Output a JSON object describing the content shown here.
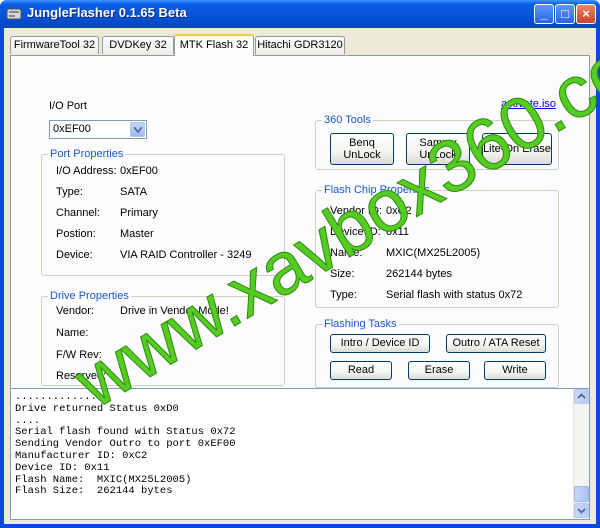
{
  "window": {
    "title": "JungleFlasher 0.1.65 Beta",
    "minimize": "_",
    "maximize": "□",
    "close": "×"
  },
  "tabs": [
    {
      "label": "FirmwareTool 32"
    },
    {
      "label": "DVDKey 32"
    },
    {
      "label": "MTK Flash 32",
      "active": true
    },
    {
      "label": "Hitachi GDR3120"
    }
  ],
  "io_port": {
    "label": "I/O Port",
    "selected": "0xEF00"
  },
  "activate_link": "activate.iso",
  "port_properties": {
    "title": "Port Properties",
    "rows": [
      {
        "label": "I/O Address:",
        "value": "0xEF00"
      },
      {
        "label": "Type:",
        "value": "SATA"
      },
      {
        "label": "Channel:",
        "value": "Primary"
      },
      {
        "label": "Postion:",
        "value": "Master"
      },
      {
        "label": "Device:",
        "value": "VIA RAID Controller - 3249"
      }
    ]
  },
  "drive_properties": {
    "title": "Drive Properties",
    "rows": [
      {
        "label": "Vendor:",
        "value": "Drive in Vendor Mode!"
      },
      {
        "label": "Name:",
        "value": ""
      },
      {
        "label": "F/W Rev:",
        "value": ""
      },
      {
        "label": "Reserved:",
        "value": ""
      }
    ]
  },
  "tools_360": {
    "title": "360 Tools",
    "buttons": [
      {
        "label": "Benq\nUnLock"
      },
      {
        "label": "Sammy\nUnLock"
      },
      {
        "label": "Lite-On Erase"
      }
    ]
  },
  "flash_chip": {
    "title": "Flash Chip Properties",
    "rows": [
      {
        "label": "Vendor ID:",
        "value": "0xC2"
      },
      {
        "label": "Device ID:",
        "value": "0x11"
      },
      {
        "label": "Name:",
        "value": "MXIC(MX25L2005)"
      },
      {
        "label": "Size:",
        "value": "262144 bytes"
      },
      {
        "label": "Type:",
        "value": "Serial flash with status 0x72"
      }
    ]
  },
  "flashing_tasks": {
    "title": "Flashing Tasks",
    "intro_label": "Intro / Device ID",
    "outro_label": "Outro / ATA Reset",
    "read_label": "Read",
    "erase_label": "Erase",
    "write_label": "Write"
  },
  "console": {
    "lines": [
      "...............",
      "Drive returned Status 0xD0",
      "....",
      "Serial flash found with Status 0x72",
      "Sending Vendor Outro to port 0xEF00",
      "Manufacturer ID: 0xC2",
      "Device ID: 0x11",
      "Flash Name:  MXIC(MX25L2005)",
      "Flash Size:  262144 bytes"
    ]
  },
  "watermark": {
    "text": "www.xavbox360.com",
    "color": "#55cc22"
  }
}
